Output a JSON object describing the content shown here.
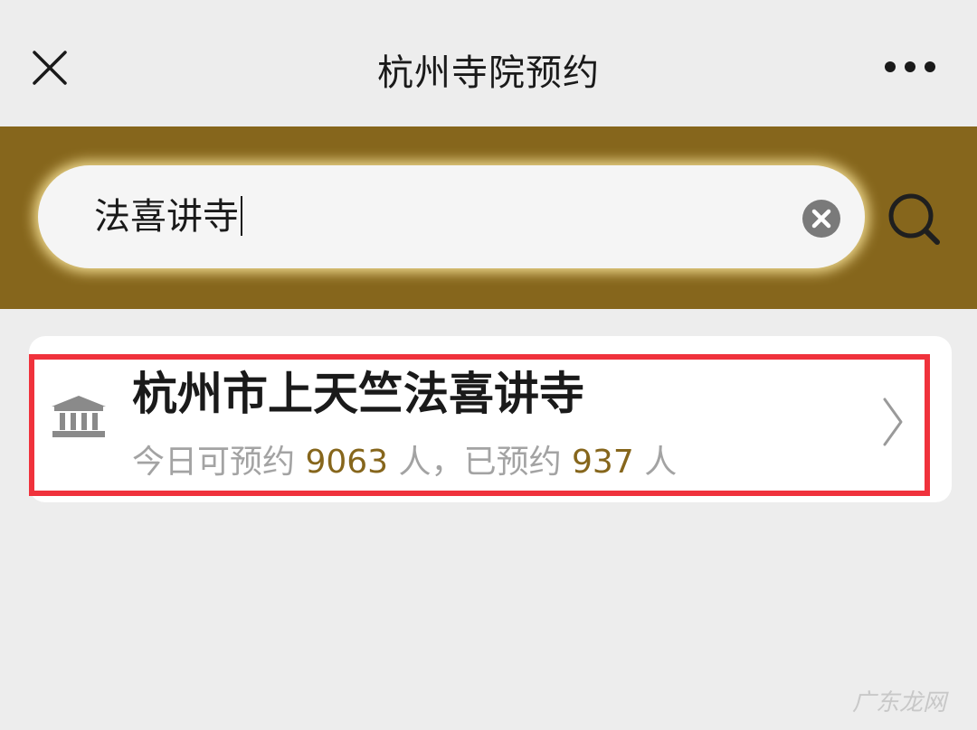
{
  "header": {
    "title": "杭州寺院预约",
    "close_icon": "close-icon",
    "more_icon": "more-icon"
  },
  "search": {
    "value": "法喜讲寺",
    "clear_icon": "clear-icon",
    "search_icon": "search-icon"
  },
  "results": [
    {
      "icon": "temple-icon",
      "name": "杭州市上天竺法喜讲寺",
      "available_prefix": "今日可预约",
      "available_count": "9063",
      "available_unit": "人，",
      "booked_prefix": "已预约",
      "booked_count": "937",
      "booked_unit": "人"
    }
  ],
  "watermark": "广东龙网",
  "colors": {
    "brand": "#86661c",
    "highlight": "#f0323c",
    "background": "#ededed"
  }
}
